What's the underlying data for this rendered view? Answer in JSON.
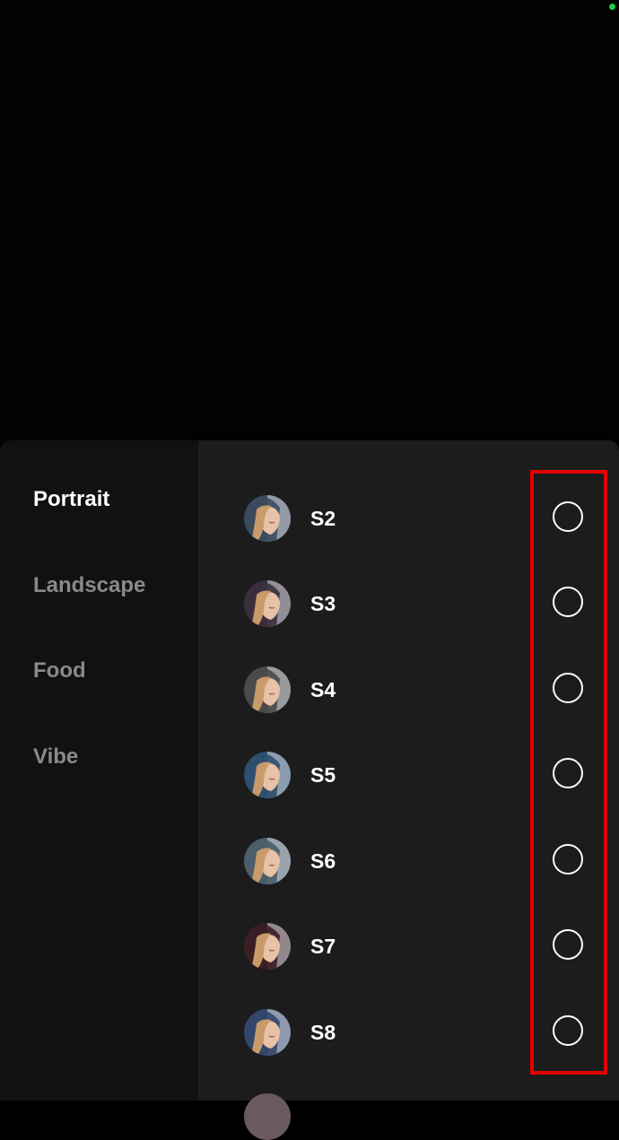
{
  "categories": [
    {
      "label": "Portrait",
      "active": true
    },
    {
      "label": "Landscape",
      "active": false
    },
    {
      "label": "Food",
      "active": false
    },
    {
      "label": "Vibe",
      "active": false
    }
  ],
  "filters": [
    {
      "label": "S2",
      "selected": false,
      "tint": "#3c4a5e"
    },
    {
      "label": "S3",
      "selected": false,
      "tint": "#3a2f3c"
    },
    {
      "label": "S4",
      "selected": false,
      "tint": "#4a4a4a"
    },
    {
      "label": "S5",
      "selected": false,
      "tint": "#2e4f6e"
    },
    {
      "label": "S6",
      "selected": false,
      "tint": "#4b5e6a"
    },
    {
      "label": "S7",
      "selected": false,
      "tint": "#3a1f24"
    },
    {
      "label": "S8",
      "selected": false,
      "tint": "#33476a"
    }
  ],
  "colors": {
    "highlight": "#e30000",
    "status_dot": "#1fcf4a"
  }
}
